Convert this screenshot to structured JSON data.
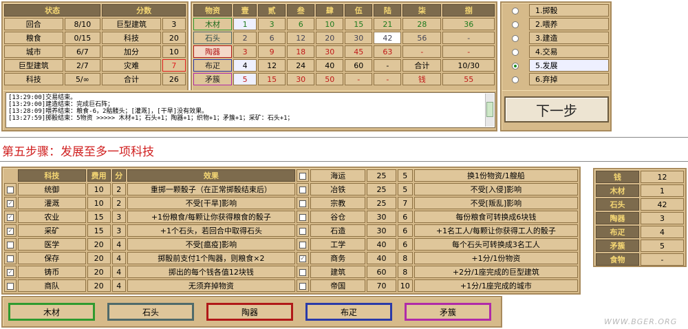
{
  "status": {
    "h1": "状态",
    "h2": "分数",
    "rows": [
      [
        "回合",
        "8/10",
        "巨型建筑",
        "3"
      ],
      [
        "粮食",
        "0/15",
        "科技",
        "20"
      ],
      [
        "城市",
        "6/7",
        "加分",
        "10"
      ],
      [
        "巨型建筑",
        "2/7",
        "灾难",
        "7"
      ],
      [
        "科技",
        "5/∞",
        "合计",
        "26"
      ]
    ]
  },
  "goods": {
    "header": [
      "物资",
      "壹",
      "贰",
      "叁",
      "肆",
      "伍",
      "陆",
      "柒",
      "捌"
    ],
    "rows": [
      [
        "木材",
        "1",
        "3",
        "6",
        "10",
        "15",
        "21",
        "28",
        "36"
      ],
      [
        "石头",
        "2",
        "6",
        "12",
        "20",
        "30",
        "42",
        "56",
        "-"
      ],
      [
        "陶器",
        "3",
        "9",
        "18",
        "30",
        "45",
        "63",
        "-",
        "-"
      ],
      [
        "布疋",
        "4",
        "12",
        "24",
        "40",
        "60",
        "-",
        "合计",
        "10/30"
      ],
      [
        "矛簇",
        "5",
        "15",
        "30",
        "50",
        "-",
        "-",
        "钱",
        "55"
      ]
    ]
  },
  "actions": [
    "1.掷骰",
    "2.喂养",
    "3.建造",
    "4.交易",
    "5.发展",
    "6.弃掉"
  ],
  "log": [
    "[13:29:00]交易结束。",
    "[13:29:00]建造结束：完成巨石阵；",
    "[13:28:09]喂养结束：粮食-6，2骷髅头；[灌溉]，[干旱]没有效果。",
    "[13:27:59]掷骰结束：5物资 >>>>> 木材+1；石头+1；陶器+1；织物+1；矛簇+1；采矿：石头+1；"
  ],
  "next_label": "下一步",
  "step_title": "第五步骤：发展至多一项科技",
  "tech": {
    "header": [
      "科技",
      "费用",
      "分",
      "效果"
    ],
    "left": [
      [
        "统御",
        "10",
        "2",
        "重掷一颗骰子（在正常掷骰结束后）"
      ],
      [
        "灌溉",
        "10",
        "2",
        "不受[干旱]影响"
      ],
      [
        "农业",
        "15",
        "3",
        "+1份粮食/每颗让你获得粮食的骰子"
      ],
      [
        "采矿",
        "15",
        "3",
        "+1个石头，若回合中取得石头"
      ],
      [
        "医学",
        "20",
        "4",
        "不受[瘟疫]影响"
      ],
      [
        "保存",
        "20",
        "4",
        "掷骰前支付1个陶器，则粮食×2"
      ],
      [
        "铸币",
        "20",
        "4",
        "掷出的每个钱各值12块钱"
      ],
      [
        "商队",
        "20",
        "4",
        "无须弃掉物资"
      ]
    ],
    "right": [
      [
        "海运",
        "25",
        "5",
        "换1份物资/1艘船"
      ],
      [
        "冶铁",
        "25",
        "5",
        "不受[入侵]影响"
      ],
      [
        "宗教",
        "25",
        "7",
        "不受[叛乱]影响"
      ],
      [
        "谷仓",
        "30",
        "6",
        "每份粮食可转换成6块钱"
      ],
      [
        "石造",
        "30",
        "6",
        "+1名工人/每颗让你获得工人的骰子"
      ],
      [
        "工学",
        "40",
        "6",
        "每个石头可转换成3名工人"
      ],
      [
        "商务",
        "40",
        "8",
        "+1分/1份物资"
      ],
      [
        "建筑",
        "60",
        "8",
        "+2分/1座完成的巨型建筑"
      ],
      [
        "帝国",
        "70",
        "10",
        "+1分/1座完成的城市"
      ]
    ]
  },
  "res": [
    [
      "钱",
      "12"
    ],
    [
      "木材",
      "1"
    ],
    [
      "石头",
      "42"
    ],
    [
      "陶器",
      "3"
    ],
    [
      "布疋",
      "4"
    ],
    [
      "矛簇",
      "5"
    ],
    [
      "食物",
      "-"
    ]
  ],
  "bottom": [
    "木材",
    "石头",
    "陶器",
    "布疋",
    "矛簇"
  ],
  "watermark": "WWW.BGER.ORG"
}
